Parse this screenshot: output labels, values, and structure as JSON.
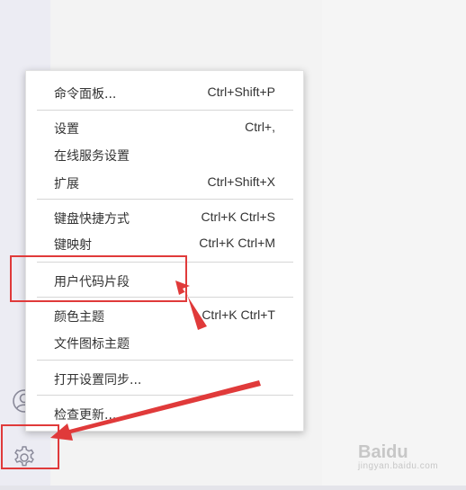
{
  "menu": {
    "items": [
      {
        "label": "命令面板...",
        "shortcut": "Ctrl+Shift+P"
      },
      {
        "label": "设置",
        "shortcut": "Ctrl+,"
      },
      {
        "label": "在线服务设置",
        "shortcut": ""
      },
      {
        "label": "扩展",
        "shortcut": "Ctrl+Shift+X"
      },
      {
        "label": "键盘快捷方式",
        "shortcut": "Ctrl+K Ctrl+S"
      },
      {
        "label": "键映射",
        "shortcut": "Ctrl+K Ctrl+M"
      },
      {
        "label": "用户代码片段",
        "shortcut": ""
      },
      {
        "label": "颜色主题",
        "shortcut": "Ctrl+K Ctrl+T"
      },
      {
        "label": "文件图标主题",
        "shortcut": ""
      },
      {
        "label": "打开设置同步...",
        "shortcut": ""
      },
      {
        "label": "检查更新...",
        "shortcut": ""
      }
    ]
  },
  "annotation": {
    "color": "#e03a3a"
  },
  "watermark": {
    "brand": "Baidu",
    "sub": "jingyan.baidu.com"
  }
}
